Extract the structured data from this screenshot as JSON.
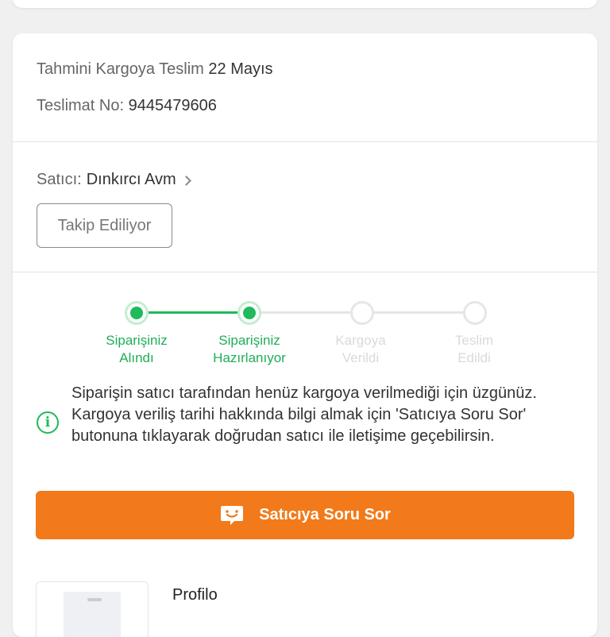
{
  "delivery": {
    "estimate_label": "Tahmini Kargoya Teslim",
    "estimate_date": "22 Mayıs",
    "number_label": "Teslimat No:",
    "number_value": "9445479606"
  },
  "seller": {
    "label": "Satıcı:",
    "name": "Dınkırcı Avm",
    "follow_button": "Takip Ediliyor"
  },
  "progress": {
    "steps": [
      {
        "line1": "Siparişiniz",
        "line2": "Alındı",
        "state": "done"
      },
      {
        "line1": "Siparişiniz",
        "line2": "Hazırlanıyor",
        "state": "done"
      },
      {
        "line1": "Kargoya",
        "line2": "Verildi",
        "state": "pending"
      },
      {
        "line1": "Teslim",
        "line2": "Edildi",
        "state": "pending"
      }
    ],
    "completed_steps": 2
  },
  "notice": {
    "icon": "info-icon",
    "text": "Siparişin satıcı tarafından henüz kargoya verilmediği için üzgünüz. Kargoya veriliş tarihi hakkında bilgi almak için 'Satıcıya Soru Sor' butonuna tıklayarak doğrudan satıcı ile iletişime geçebilirsin."
  },
  "ask_seller_button": {
    "label": "Satıcıya Soru Sor",
    "icon": "chat-bubble-icon"
  },
  "product": {
    "brand": "Profilo"
  },
  "colors": {
    "accent_orange": "#f27a1a",
    "progress_green": "#1fba5c",
    "inactive_grey": "#e6e6e6"
  }
}
